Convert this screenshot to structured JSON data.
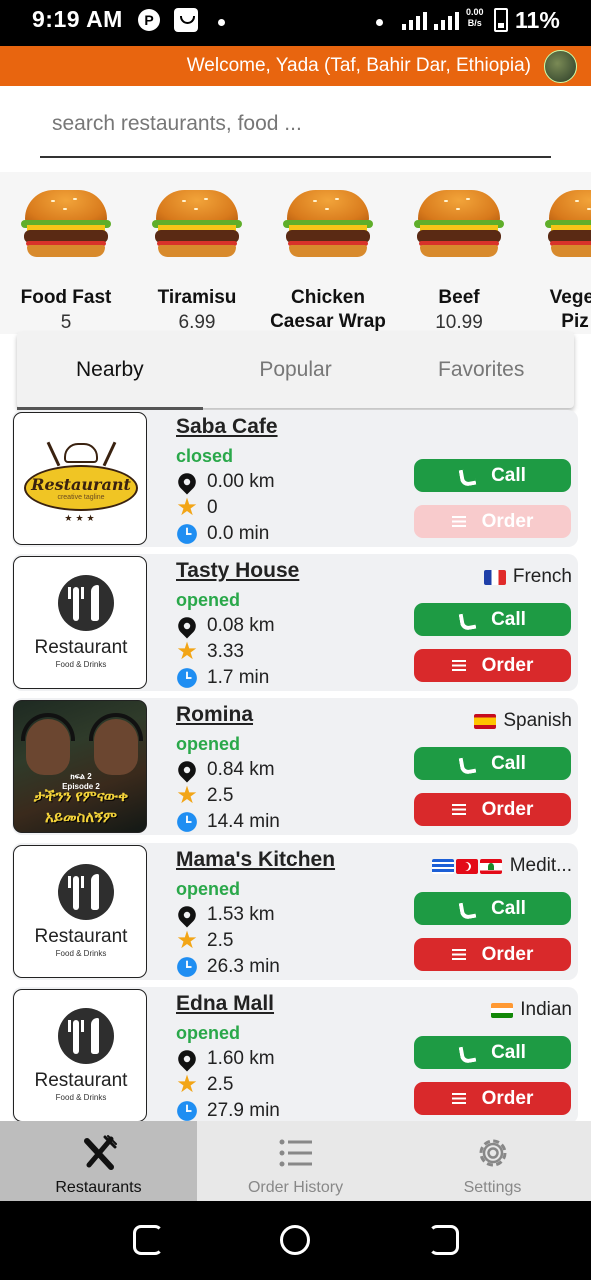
{
  "status_bar": {
    "time": "9:19 AM",
    "net_speed_top": "0.00",
    "net_speed_bottom": "B/s",
    "battery": "11%"
  },
  "header": {
    "welcome": "Welcome, Yada (Taf, Bahir Dar, Ethiopia)"
  },
  "search": {
    "placeholder": "search restaurants, food ..."
  },
  "foods": [
    {
      "name": "Food Fast",
      "price": "5"
    },
    {
      "name": "Tiramisu",
      "price": "6.99"
    },
    {
      "name": "Chicken Caesar Wrap",
      "price": ""
    },
    {
      "name": "Beef",
      "price": "10.99"
    },
    {
      "name": "Veget Piz",
      "price": ""
    }
  ],
  "tabs": [
    "Nearby",
    "Popular",
    "Favorites"
  ],
  "active_tab": "Nearby",
  "buttons": {
    "call": "Call",
    "order": "Order"
  },
  "restaurants": [
    {
      "name": "Saba Cafe",
      "status": "closed",
      "distance": "0.00 km",
      "rating": "0",
      "time": "0.0 min",
      "cuisine": "",
      "logo": {
        "title": "Restaurant",
        "subtitle": "creative tagline"
      }
    },
    {
      "name": "Tasty House",
      "status": "opened",
      "distance": "0.08 km",
      "rating": "3.33",
      "time": "1.7 min",
      "cuisine": "French",
      "logo": {
        "title": "Restaurant",
        "subtitle": "Food & Drinks"
      }
    },
    {
      "name": "Romina",
      "status": "opened",
      "distance": "0.84 km",
      "rating": "2.5",
      "time": "14.4 min",
      "cuisine": "Spanish",
      "logo": {
        "episode_line1": "ክፍል 2",
        "episode_line2": "Episode 2",
        "title_line1": "ታችንን የምናውቀ",
        "title_line2": "አይመስለኝም"
      }
    },
    {
      "name": "Mama's Kitchen",
      "status": "opened",
      "distance": "1.53 km",
      "rating": "2.5",
      "time": "26.3 min",
      "cuisine": "Medit...",
      "logo": {
        "title": "Restaurant",
        "subtitle": "Food & Drinks"
      }
    },
    {
      "name": "Edna Mall",
      "status": "opened",
      "distance": "1.60 km",
      "rating": "2.5",
      "time": "27.9 min",
      "cuisine": "Indian",
      "logo": {
        "title": "Restaurant",
        "subtitle": "Food & Drinks"
      }
    }
  ],
  "bottom_nav": [
    {
      "label": "Restaurants",
      "icon": "utensils-crossed-icon"
    },
    {
      "label": "Order History",
      "icon": "list-icon"
    },
    {
      "label": "Settings",
      "icon": "gear-icon"
    }
  ],
  "colors": {
    "header_orange": "#e8650f",
    "call_green": "#1e9b44",
    "order_red": "#d9292b",
    "status_green": "#2aa84a"
  }
}
